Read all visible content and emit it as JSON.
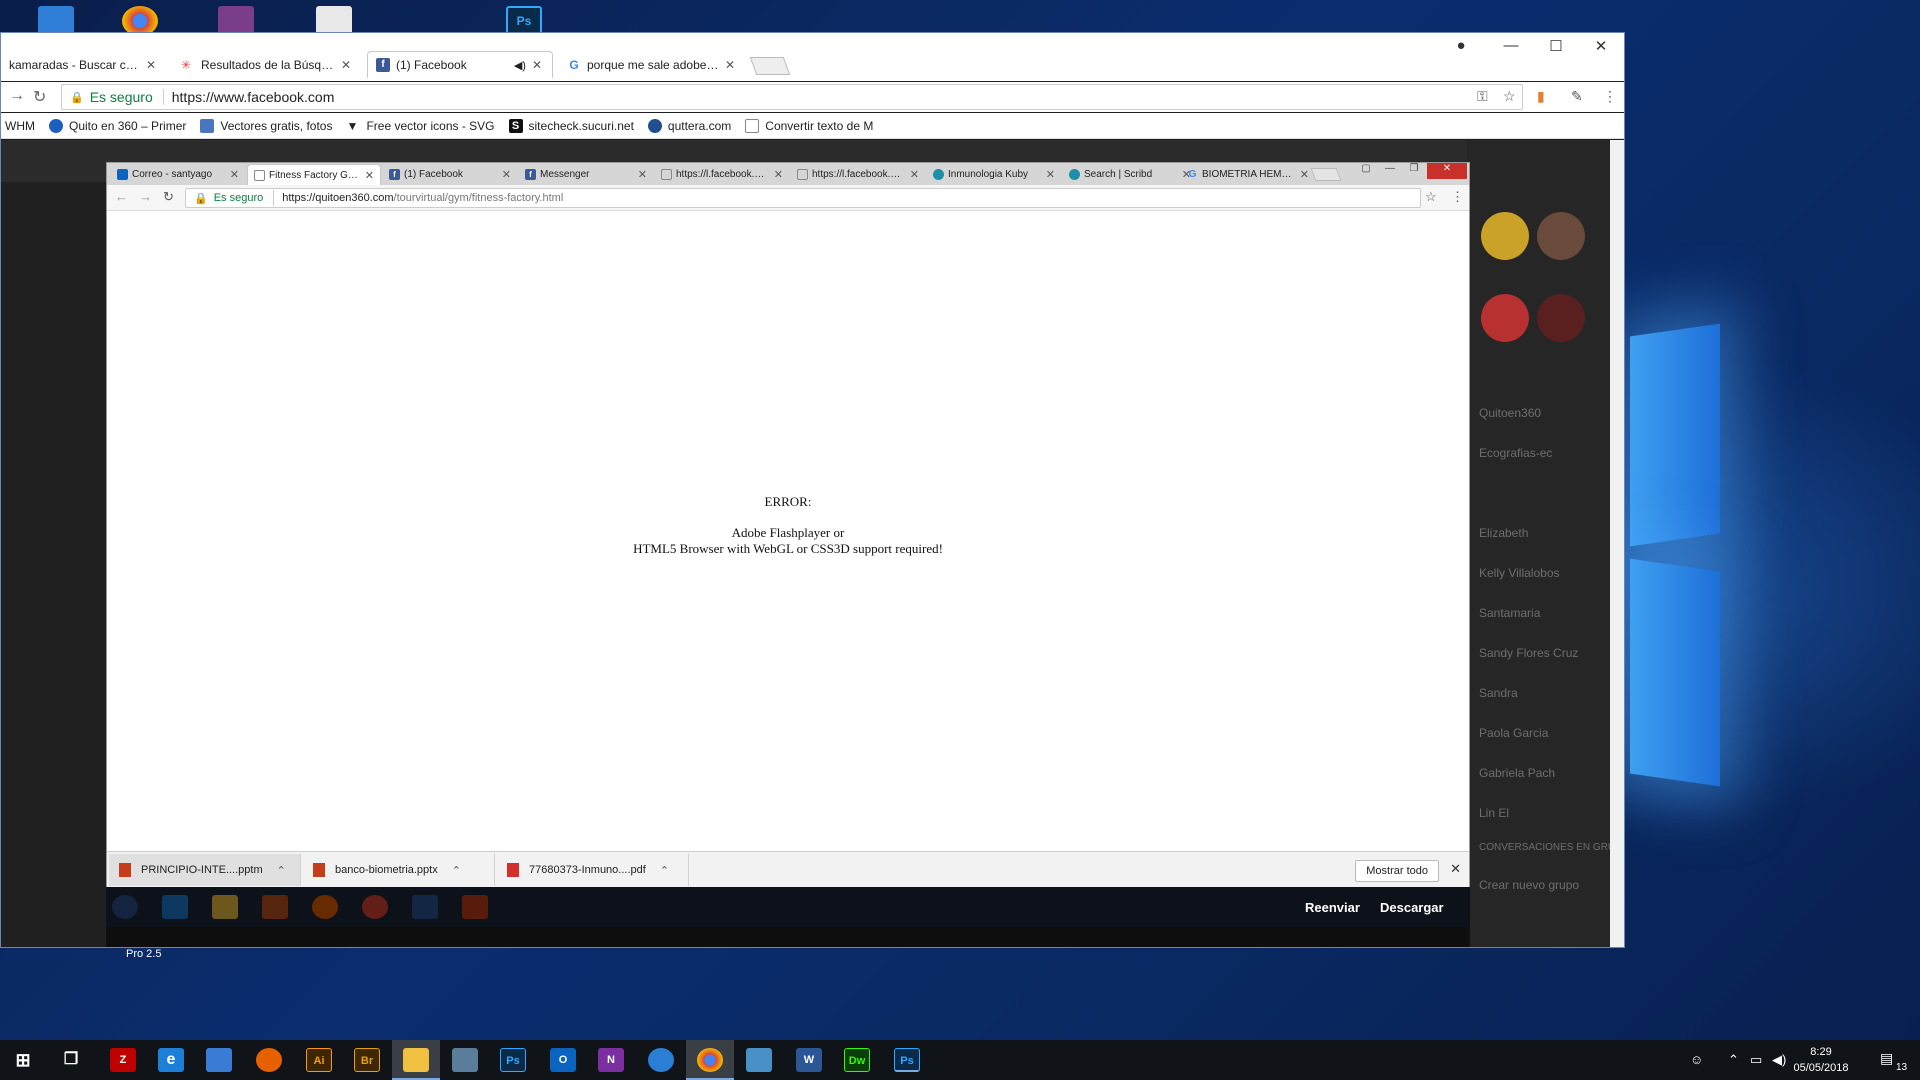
{
  "outer_browser": {
    "tabs": [
      {
        "label": "kamaradas - Buscar con Google"
      },
      {
        "label": "Resultados de la Búsqueda"
      },
      {
        "label": "(1) Facebook"
      },
      {
        "label": "porque me sale adobe flash"
      }
    ],
    "secure_label": "Es seguro",
    "url": "https://www.facebook.com",
    "bookmarks": [
      {
        "label": "WHM"
      },
      {
        "label": "Quito en 360 – Primer"
      },
      {
        "label": "Vectores gratis, fotos"
      },
      {
        "label": "Free vector icons - SVG"
      },
      {
        "label": "sitecheck.sucuri.net"
      },
      {
        "label": "quttera.com"
      },
      {
        "label": "Convertir texto de M"
      }
    ]
  },
  "inner_browser": {
    "tabs": [
      {
        "label": "Correo - santyago"
      },
      {
        "label": "Fitness Factory Gym"
      },
      {
        "label": "(1) Facebook"
      },
      {
        "label": "Messenger"
      },
      {
        "label": "https://l.facebook.com"
      },
      {
        "label": "https://l.facebook.com"
      },
      {
        "label": "Inmunologia Kuby"
      },
      {
        "label": "Search | Scribd"
      },
      {
        "label": "BIOMETRIA HEMATICA"
      }
    ],
    "secure_label": "Es seguro",
    "url_host": "https://quitoen360.com",
    "url_path": "/tourvirtual/gym/fitness-factory.html",
    "error": {
      "title": "ERROR:",
      "line1": "Adobe Flashplayer or",
      "line2": "HTML5 Browser with WebGL or CSS3D support required!"
    },
    "downloads": [
      {
        "name": "PRINCIPIO-INTE....pptm",
        "color": "#c43e1c"
      },
      {
        "name": "banco-biometria.pptx",
        "color": "#c43e1c"
      },
      {
        "name": "77680373-Inmuno....pdf",
        "color": "#d32f2f"
      }
    ],
    "show_all": "Mostrar todo"
  },
  "media_actions": {
    "forward": "Reenviar",
    "download": "Descargar"
  },
  "desktop": {
    "label": "Pro 2.5"
  },
  "taskbar": {
    "apps": [
      {
        "name": "filezilla",
        "label": "Z",
        "color": "#bf0000"
      },
      {
        "name": "edge",
        "label": "e",
        "color": "#1e7fd8"
      },
      {
        "name": "store",
        "label": "",
        "color": "#3a7bd5"
      },
      {
        "name": "firefox",
        "label": "",
        "color": "#e66000"
      },
      {
        "name": "illustrator",
        "label": "Ai",
        "color": "#3d2600"
      },
      {
        "name": "bridge",
        "label": "Br",
        "color": "#3d2600"
      },
      {
        "name": "explorer",
        "label": "",
        "color": "#f0c040"
      },
      {
        "name": "remote-desktop",
        "label": "",
        "color": "#5a7d9a"
      },
      {
        "name": "photoshop",
        "label": "Ps",
        "color": "#0a2a4a"
      },
      {
        "name": "outlook",
        "label": "O",
        "color": "#0a64c0"
      },
      {
        "name": "onenote",
        "label": "N",
        "color": "#7b2fa0"
      },
      {
        "name": "thunderbird",
        "label": "",
        "color": "#2a7fd4"
      },
      {
        "name": "chrome",
        "label": "",
        "color": "#db4437"
      },
      {
        "name": "app-settings",
        "label": "",
        "color": "#4a90c8"
      },
      {
        "name": "word",
        "label": "W",
        "color": "#2b5797"
      },
      {
        "name": "dreamweaver",
        "label": "Dw",
        "color": "#0b3d0b"
      },
      {
        "name": "photoshop-2",
        "label": "Ps",
        "color": "#0a2a4a"
      }
    ],
    "time": "8:29",
    "date": "05/05/2018",
    "notification_count": "13"
  },
  "fb_sidebar": {
    "items": [
      "Quitoen360",
      "Ecografias-ec",
      "Elizabeth",
      "Kelly Villalobos",
      "Santamaria",
      "Sandy Flores Cruz",
      "Sandra",
      "Paola Garcia",
      "Gabriela Pach",
      "Lin El",
      "CONVERSACIONES EN GRUPO",
      "Crear nuevo grupo"
    ]
  }
}
